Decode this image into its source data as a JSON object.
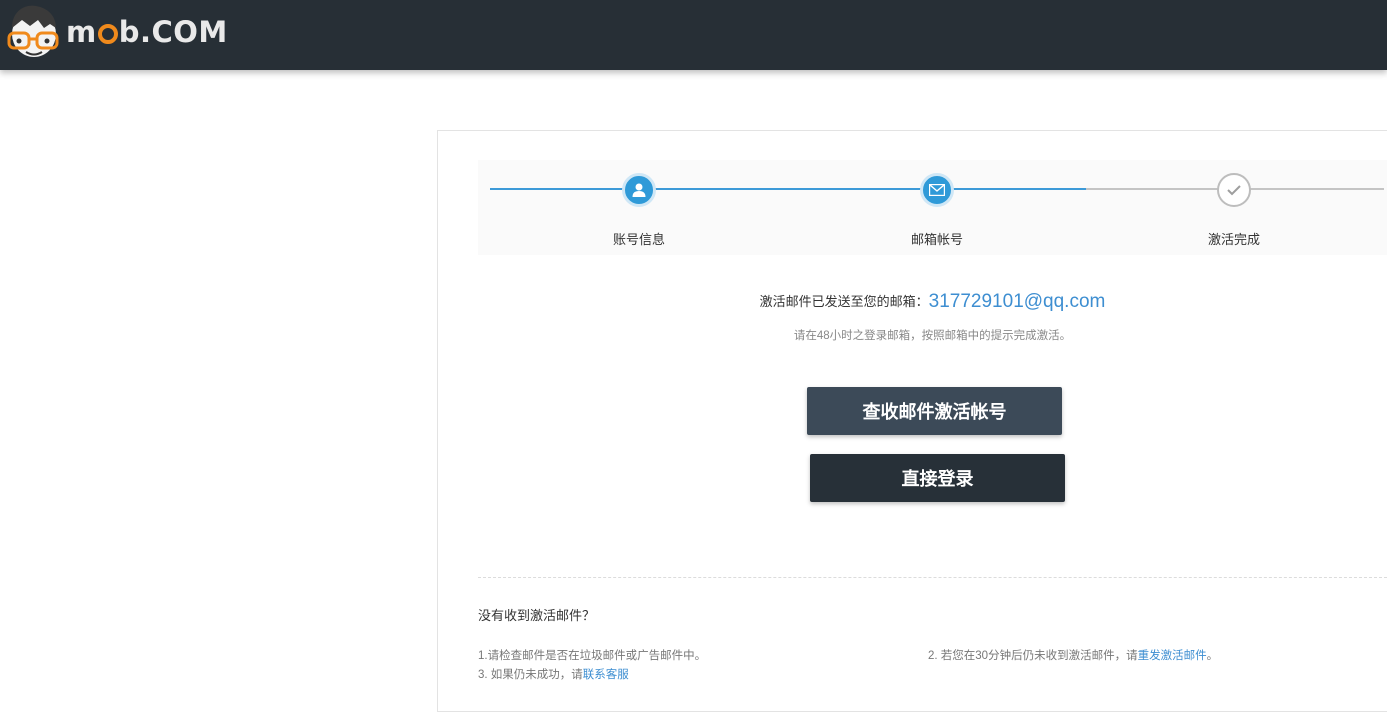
{
  "header": {
    "logo_text_prefix": "m",
    "logo_text_suffix": "b.COM",
    "brand_color": "#f08a1c",
    "background": "#272f36"
  },
  "steps": [
    {
      "label": "账号信息",
      "icon": "user-icon",
      "state": "done"
    },
    {
      "label": "邮箱帐号",
      "icon": "mail-icon",
      "state": "current"
    },
    {
      "label": "激活完成",
      "icon": "check-icon",
      "state": "todo"
    }
  ],
  "message": {
    "text": "激活邮件已发送至您的邮箱：",
    "email": "317729101@qq.com",
    "hint": "请在48小时之登录邮箱，按照邮箱中的提示完成激活。"
  },
  "buttons": {
    "check_mail": "查收邮件激活帐号",
    "login": "直接登录"
  },
  "faq": {
    "title": "没有收到激活邮件？",
    "item1": "1.请检查邮件是否在垃圾邮件或广告邮件中。",
    "item2_prefix": "2. 若您在30分钟后仍未收到激活邮件，请",
    "item2_link": "重发激活邮件",
    "item2_suffix": "。",
    "item3_prefix": "3. 如果仍未成功，请",
    "item3_link": "联系客服"
  },
  "colors": {
    "accent": "#2f9ad8",
    "link": "#3d8ed1",
    "button_primary": "#3c4a58",
    "button_dark": "#273038"
  }
}
